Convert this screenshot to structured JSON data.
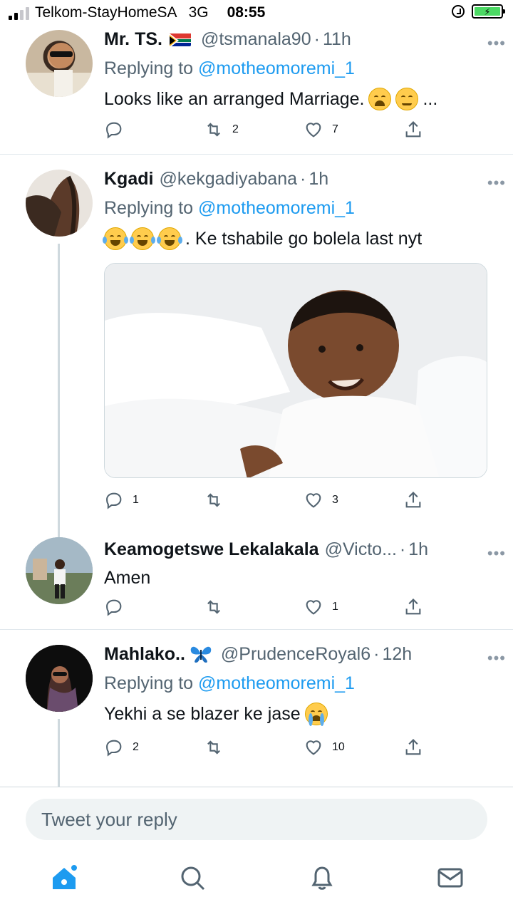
{
  "status": {
    "carrier": "Telkom-StayHomeSA",
    "network": "3G",
    "time": "08:55"
  },
  "tweets": [
    {
      "name": "Mr. TS.",
      "flag": "south-africa-flag",
      "handle": "@tsmanala90",
      "dot": "·",
      "time": "11h",
      "replying_prefix": "Replying to",
      "replying_to": "@motheomoremi_1",
      "text": "Looks like an arranged Marriage.",
      "text_suffix": "...",
      "replies": "",
      "retweets": "2",
      "likes": "7"
    },
    {
      "name": "Kgadi",
      "handle": "@kekgadiyabana",
      "dot": "·",
      "time": "1h",
      "replying_prefix": "Replying to",
      "replying_to": "@motheomoremi_1",
      "text": ". Ke tshabile go bolela last nyt",
      "replies": "1",
      "retweets": "",
      "likes": "3"
    },
    {
      "name": "Keamogetswe Lekalakala",
      "handle": "@Victo...",
      "dot": "·",
      "time": "1h",
      "text": "Amen",
      "replies": "",
      "retweets": "",
      "likes": "1"
    },
    {
      "name": "Mahlako..",
      "handle": "@PrudenceRoyal6",
      "dot": "·",
      "time": "12h",
      "replying_prefix": "Replying to",
      "replying_to": "@motheomoremi_1",
      "text": "Yekhi a se blazer ke jase",
      "replies": "2",
      "retweets": "",
      "likes": "10"
    }
  ],
  "more_label": "•••",
  "reply_placeholder": "Tweet your reply",
  "colors": {
    "accent": "#1d9bf0",
    "muted": "#536471"
  }
}
